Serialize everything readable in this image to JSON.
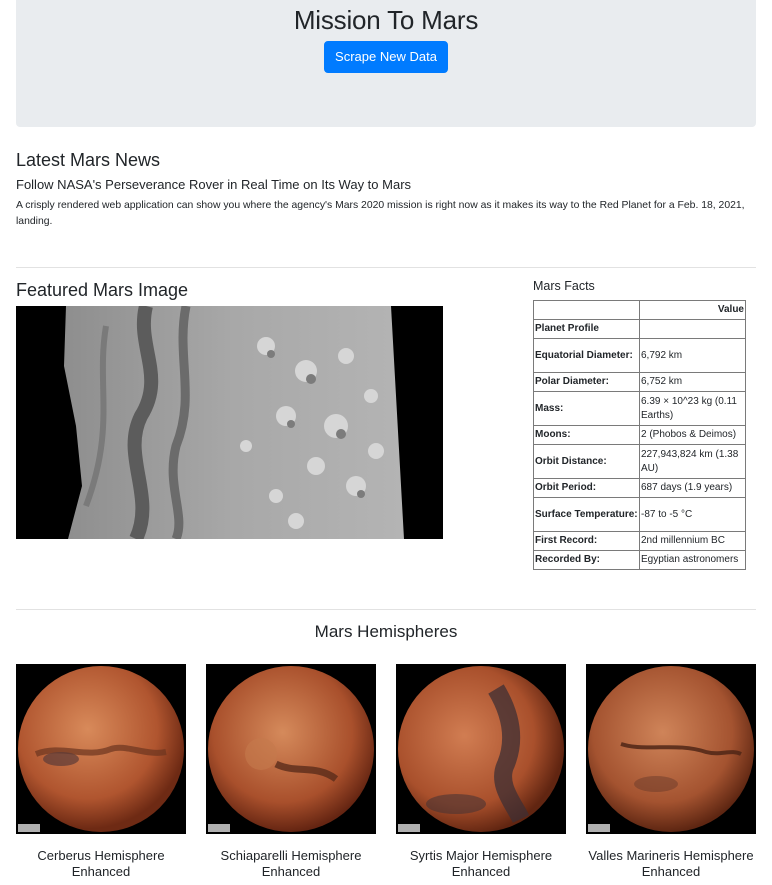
{
  "header": {
    "title": "Mission To Mars",
    "scrape_label": "Scrape New Data"
  },
  "news": {
    "heading": "Latest Mars News",
    "title": "Follow NASA's Perseverance Rover in Real Time on Its Way to Mars",
    "paragraph": "A crisply rendered web application can show you where the agency's Mars 2020 mission is right now as it makes its way to the Red Planet for a Feb. 18, 2021, landing."
  },
  "featured": {
    "heading": "Featured Mars Image"
  },
  "facts": {
    "heading": "Mars Facts",
    "columns": [
      "",
      "Value"
    ],
    "rows": [
      {
        "label": "Planet Profile",
        "value": ""
      },
      {
        "label": "Equatorial Diameter:",
        "value": "6,792 km"
      },
      {
        "label": "Polar Diameter:",
        "value": "6,752 km"
      },
      {
        "label": "Mass:",
        "value": "6.39 × 10^23 kg (0.11 Earths)"
      },
      {
        "label": "Moons:",
        "value": "2 (Phobos & Deimos)"
      },
      {
        "label": "Orbit Distance:",
        "value": "227,943,824 km (1.38 AU)"
      },
      {
        "label": "Orbit Period:",
        "value": "687 days (1.9 years)"
      },
      {
        "label": "Surface Temperature:",
        "value": "-87 to -5 °C"
      },
      {
        "label": "First Record:",
        "value": "2nd millennium BC"
      },
      {
        "label": "Recorded By:",
        "value": "Egyptian astronomers"
      }
    ]
  },
  "hemispheres": {
    "heading": "Mars Hemispheres",
    "items": [
      {
        "caption": "Cerberus Hemisphere Enhanced"
      },
      {
        "caption": "Schiaparelli Hemisphere Enhanced"
      },
      {
        "caption": "Syrtis Major Hemisphere Enhanced"
      },
      {
        "caption": "Valles Marineris Hemisphere Enhanced"
      }
    ]
  }
}
